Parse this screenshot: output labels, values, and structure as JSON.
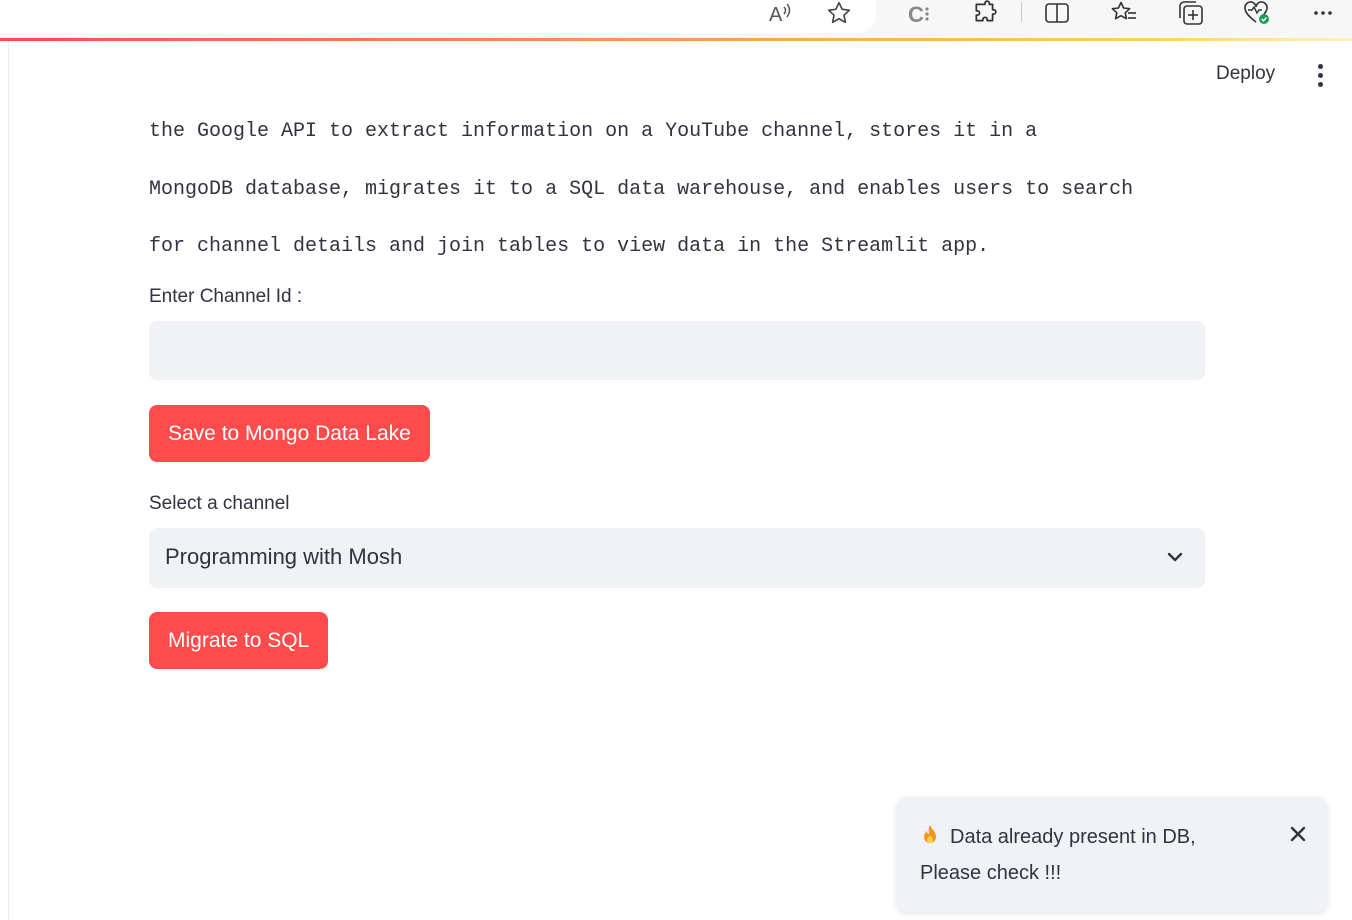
{
  "browser": {
    "icons": [
      "read-aloud-icon",
      "favorite-star-icon",
      "copilot-icon",
      "extensions-icon",
      "split-screen-icon",
      "favorites-icon",
      "collections-icon",
      "browser-essentials-icon",
      "more-options-icon"
    ]
  },
  "header": {
    "deploy_label": "Deploy"
  },
  "main": {
    "description_lines": [
      "the Google API to extract information on a YouTube channel, stores it in a",
      "MongoDB database, migrates it to a SQL data warehouse, and enables users to search",
      "for channel details and join tables to view data in the Streamlit app."
    ],
    "channel_input": {
      "label": "Enter Channel Id :",
      "value": ""
    },
    "save_button_label": "Save to Mongo Data Lake",
    "channel_select": {
      "label": "Select a channel",
      "selected": "Programming with Mosh"
    },
    "migrate_button_label": "Migrate to SQL"
  },
  "toast": {
    "message": "Data already present in DB, Please check !!!",
    "icon": "fire-icon"
  },
  "colors": {
    "primary": "#ff4b4b",
    "input_bg": "#f0f2f6",
    "text": "#31333f"
  }
}
